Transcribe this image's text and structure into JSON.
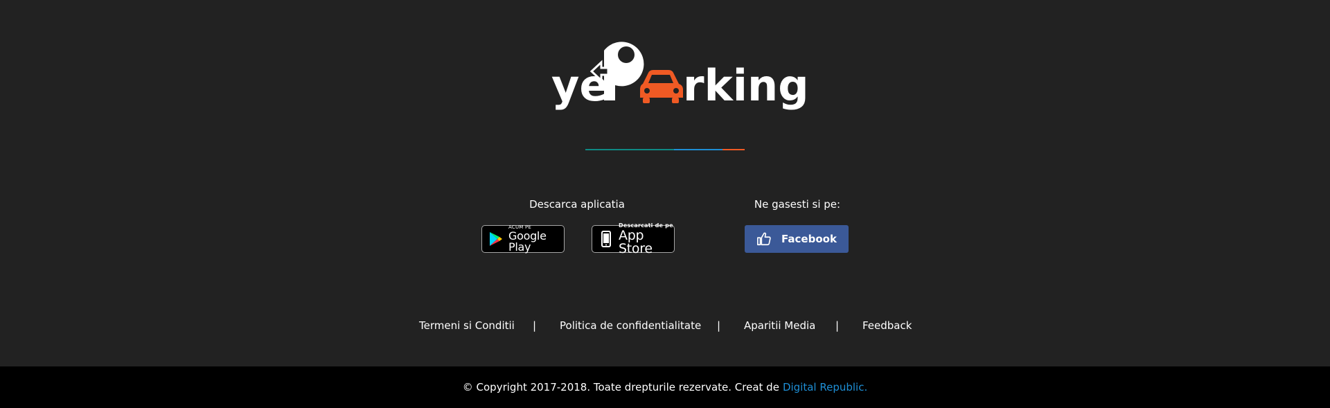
{
  "logo": {
    "text_left": "ye",
    "text_right": "rking",
    "colors": {
      "white": "#ffffff",
      "car": "#f05a24"
    }
  },
  "divider": {
    "colors": [
      "#0f8a84",
      "#1e8fd6",
      "#f05a24"
    ]
  },
  "download": {
    "heading": "Descarca aplicatia",
    "google_play": {
      "small": "ACUM PE",
      "big": "Google Play",
      "icon": "google-play-icon"
    },
    "app_store": {
      "small": "Descarcati de pe",
      "big": "App Store",
      "icon": "phone-icon"
    }
  },
  "social": {
    "heading": "Ne gasesti si pe:",
    "facebook": {
      "label": "Facebook",
      "icon": "thumbs-up-icon",
      "color": "#3b5998"
    }
  },
  "footer_links": {
    "terms": "Termeni si Conditii",
    "privacy": "Politica de confidentialitate",
    "media": "Aparitii Media",
    "feedback": "Feedback",
    "separator": "|"
  },
  "copyright": {
    "text": "© Copyright 2017-2018. Toate drepturile rezervate. Creat de",
    "link": "Digital Republic.",
    "link_color": "#1e8fd6"
  }
}
